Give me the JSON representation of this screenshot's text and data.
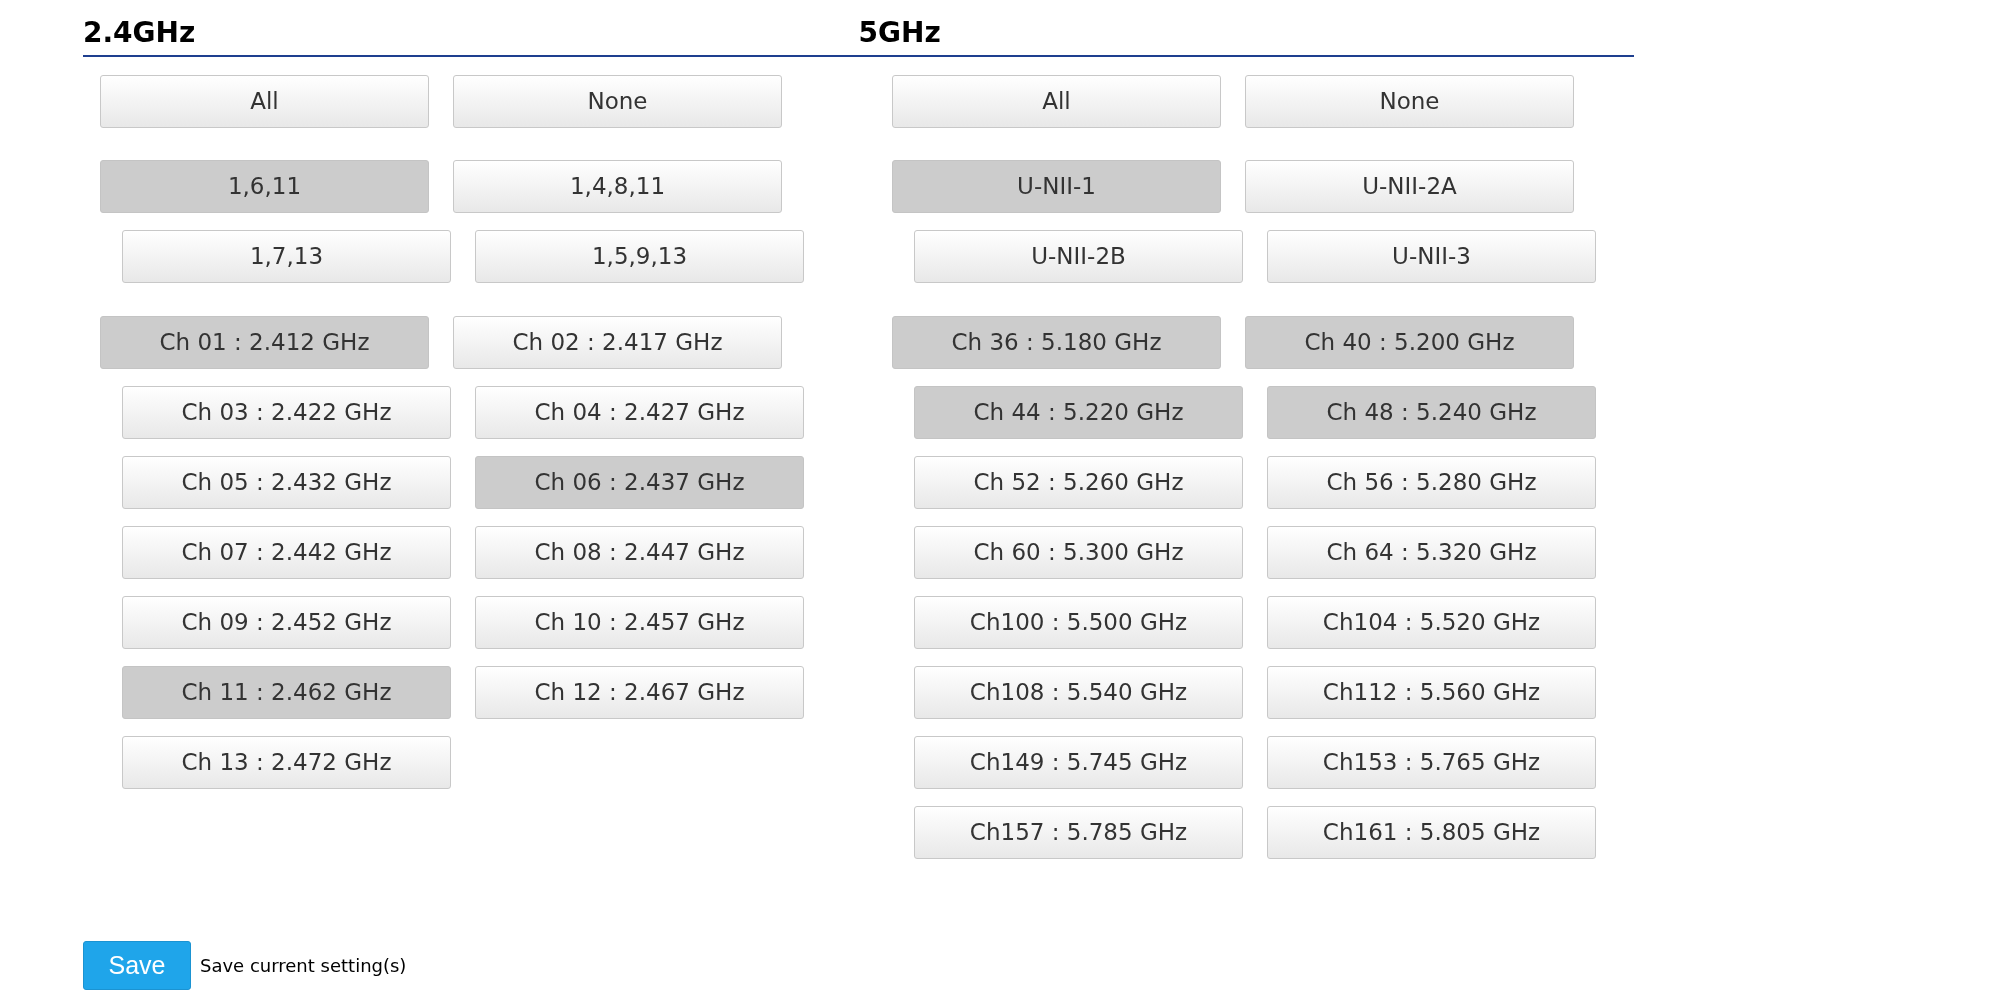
{
  "bands": [
    {
      "title": "2.4GHz",
      "quick": [
        "All",
        "None"
      ],
      "groups": [
        {
          "label": "1,6,11",
          "selected": true
        },
        {
          "label": "1,4,8,11",
          "selected": false
        },
        {
          "label": "1,7,13",
          "selected": false
        },
        {
          "label": "1,5,9,13",
          "selected": false
        }
      ],
      "channels": [
        {
          "label": "Ch 01 : 2.412 GHz",
          "selected": true
        },
        {
          "label": "Ch 02 : 2.417 GHz",
          "selected": false
        },
        {
          "label": "Ch 03 : 2.422 GHz",
          "selected": false
        },
        {
          "label": "Ch 04 : 2.427 GHz",
          "selected": false
        },
        {
          "label": "Ch 05 : 2.432 GHz",
          "selected": false
        },
        {
          "label": "Ch 06 : 2.437 GHz",
          "selected": true
        },
        {
          "label": "Ch 07 : 2.442 GHz",
          "selected": false
        },
        {
          "label": "Ch 08 : 2.447 GHz",
          "selected": false
        },
        {
          "label": "Ch 09 : 2.452 GHz",
          "selected": false
        },
        {
          "label": "Ch 10 : 2.457 GHz",
          "selected": false
        },
        {
          "label": "Ch 11 : 2.462 GHz",
          "selected": true
        },
        {
          "label": "Ch 12 : 2.467 GHz",
          "selected": false
        },
        {
          "label": "Ch 13 : 2.472 GHz",
          "selected": false
        }
      ]
    },
    {
      "title": "5GHz",
      "quick": [
        "All",
        "None"
      ],
      "groups": [
        {
          "label": "U-NII-1",
          "selected": true
        },
        {
          "label": "U-NII-2A",
          "selected": false
        },
        {
          "label": "U-NII-2B",
          "selected": false
        },
        {
          "label": "U-NII-3",
          "selected": false
        }
      ],
      "channels": [
        {
          "label": "Ch 36 : 5.180 GHz",
          "selected": true
        },
        {
          "label": "Ch 40 : 5.200 GHz",
          "selected": true
        },
        {
          "label": "Ch 44 : 5.220 GHz",
          "selected": true
        },
        {
          "label": "Ch 48 : 5.240 GHz",
          "selected": true
        },
        {
          "label": "Ch 52 : 5.260 GHz",
          "selected": false
        },
        {
          "label": "Ch 56 : 5.280 GHz",
          "selected": false
        },
        {
          "label": "Ch 60 : 5.300 GHz",
          "selected": false
        },
        {
          "label": "Ch 64 : 5.320 GHz",
          "selected": false
        },
        {
          "label": "Ch100 : 5.500 GHz",
          "selected": false
        },
        {
          "label": "Ch104 : 5.520 GHz",
          "selected": false
        },
        {
          "label": "Ch108 : 5.540 GHz",
          "selected": false
        },
        {
          "label": "Ch112 : 5.560 GHz",
          "selected": false
        },
        {
          "label": "Ch149 : 5.745 GHz",
          "selected": false
        },
        {
          "label": "Ch153 : 5.765 GHz",
          "selected": false
        },
        {
          "label": "Ch157 : 5.785 GHz",
          "selected": false
        },
        {
          "label": "Ch161 : 5.805 GHz",
          "selected": false
        }
      ]
    }
  ],
  "save": {
    "button": "Save",
    "note": "Save current setting(s)"
  }
}
